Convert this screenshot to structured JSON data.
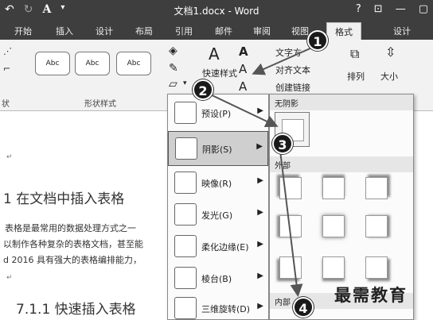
{
  "titlebar": {
    "undo_icon": "undo-icon",
    "redo_icon": "redo-icon",
    "font_icon": "font-icon",
    "title": "文档1.docx - Word",
    "help": "?"
  },
  "tabs": [
    "开始",
    "插入",
    "设计",
    "布局",
    "引用",
    "邮件",
    "审阅",
    "视图",
    "格式",
    "设计"
  ],
  "ribbon": {
    "style_samples": [
      "Abc",
      "Abc",
      "Abc"
    ],
    "group_shape_styles": "形状样式",
    "group_left_fragment": "状",
    "quick_styles": "快速样式",
    "text_direction": "文字方",
    "align_text": "对齐文本",
    "create_link": "创建链接",
    "arrange": "排列",
    "size": "大小"
  },
  "document": {
    "heading1": "1 在文档中插入表格",
    "para1": "表格是最常用的数据处理方式之一",
    "para2": "以制作各种复杂的表格文档，甚至能",
    "para3": "d 2016 具有强大的表格编排能力，",
    "heading2": "7.1.1 快速插入表格",
    "para_mark": "↵"
  },
  "effects_menu": {
    "items": [
      {
        "label": "预设(P)"
      },
      {
        "label": "阴影(S)"
      },
      {
        "label": "映像(R)"
      },
      {
        "label": "发光(G)"
      },
      {
        "label": "柔化边缘(E)"
      },
      {
        "label": "棱台(B)"
      },
      {
        "label": "三维旋转(D)"
      }
    ]
  },
  "shadow_menu": {
    "no_shadow": "无阴影",
    "outer": "外部",
    "inner": "内部"
  },
  "callouts": [
    "1",
    "2",
    "3",
    "4"
  ],
  "watermark": "最需教育"
}
